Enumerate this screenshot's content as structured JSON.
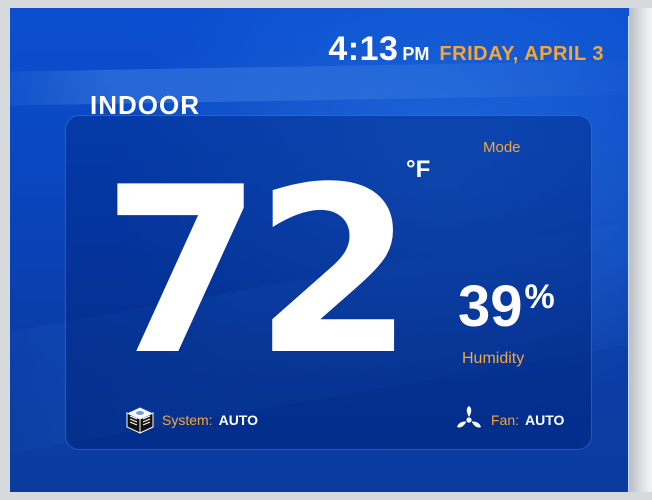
{
  "header": {
    "time": "4:13",
    "ampm": "PM",
    "date": "FRIDAY, APRIL 3"
  },
  "labels": {
    "indoor": "INDOOR",
    "mode": "Mode",
    "humidity": "Humidity"
  },
  "readings": {
    "temperature": "72",
    "unit": "°F",
    "humidity_value": "39",
    "humidity_unit": "%"
  },
  "status": {
    "system": {
      "label": "System:",
      "value": "AUTO",
      "icon": "system-icon"
    },
    "fan": {
      "label": "Fan:",
      "value": "AUTO",
      "icon": "fan-icon"
    }
  },
  "colors": {
    "accent": "#f3a73a",
    "background": "#0a43b9",
    "text": "#ffffff"
  }
}
